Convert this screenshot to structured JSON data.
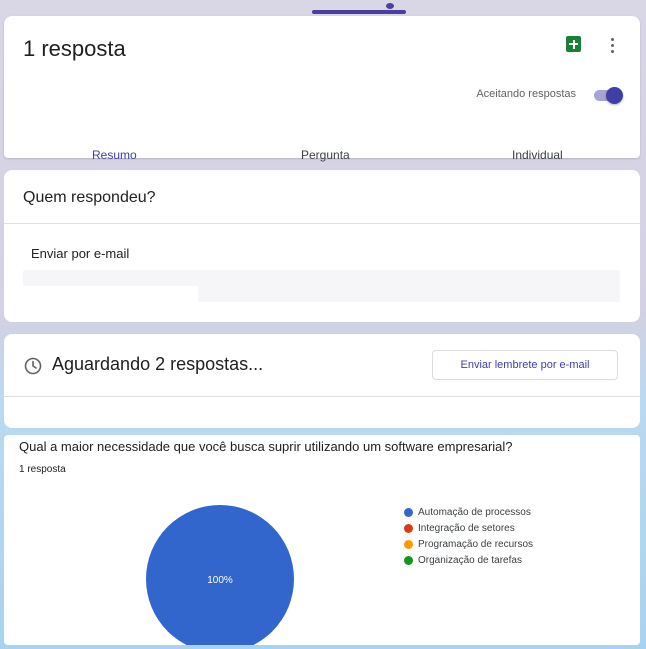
{
  "header": {
    "title": "1 resposta",
    "accepting_label": "Aceitando respostas",
    "accepting_on": true,
    "sheets_icon": "google-sheets-icon",
    "more_icon": "more-vert-icon"
  },
  "tabs": [
    {
      "label": "Resumo",
      "active": true
    },
    {
      "label": "Pergunta",
      "active": false
    },
    {
      "label": "Individual",
      "active": false
    }
  ],
  "who": {
    "title": "Quem respondeu?",
    "send_email_label": "Enviar por e-mail",
    "email_value": ""
  },
  "awaiting": {
    "clock_icon": "clock-icon",
    "text": "Aguardando 2 respostas...",
    "reminder_button": "Enviar lembrete por e-mail"
  },
  "question": {
    "title": "Qual a maior necessidade que você busca suprir utilizando um software empresarial?",
    "count": "1 resposta"
  },
  "colors": {
    "accent": "#3f3fa6",
    "sheets_green": "#188038"
  },
  "chart_data": {
    "type": "pie",
    "categories": [
      "Automação de processos",
      "Integração de setores",
      "Programação de recursos",
      "Organização de tarefas"
    ],
    "values": [
      100,
      0,
      0,
      0
    ],
    "colors": [
      "#3366cc",
      "#dc3912",
      "#ff9900",
      "#109618"
    ],
    "slice_labels": [
      "100%"
    ],
    "legend_position": "right"
  }
}
